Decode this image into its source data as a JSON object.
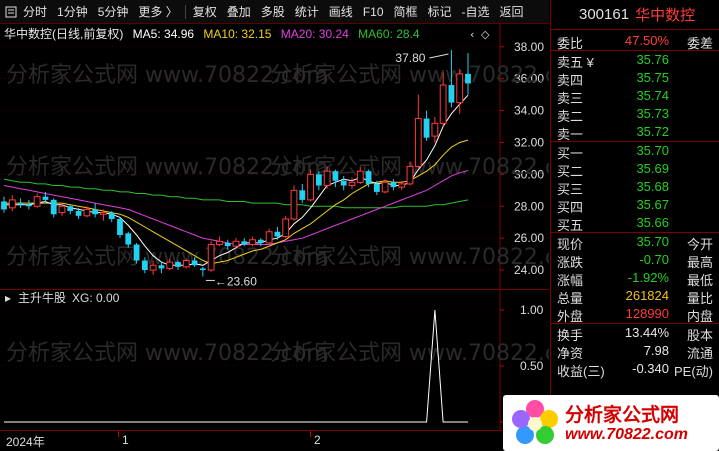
{
  "toolbar": {
    "items": [
      "分时",
      "1分钟",
      "5分钟",
      "更多 〉",
      "复权",
      "叠加",
      "多股",
      "统计",
      "画线",
      "F10",
      "简框",
      "标记",
      "-自选",
      "返回"
    ]
  },
  "stock": {
    "code": "300161",
    "name": "华中数控"
  },
  "chart_header": {
    "title": "华中数控(日线,前复权)",
    "ma5": "MA5: 34.96",
    "ma10": "MA10: 32.15",
    "ma20": "MA20: 30.24",
    "ma60": "MA60: 28.4"
  },
  "colors": {
    "up": "#ff3a3a",
    "down": "#22d0f0",
    "ma5": "#ffffff",
    "ma10": "#f0d020",
    "ma20": "#e040e0",
    "ma60": "#30c030",
    "grid": "#5a0000"
  },
  "price_axis": [
    "38.00",
    "36.00",
    "34.00",
    "32.00",
    "30.00",
    "28.00",
    "26.00",
    "24.00"
  ],
  "annotations": {
    "high": "37.80",
    "low": "23.60"
  },
  "indicator": {
    "name": "主升牛股",
    "xg": "XG: 0.00",
    "axis": [
      "1.00",
      "0.50",
      "0.00"
    ]
  },
  "xaxis": {
    "labels": [
      "2024年",
      "1",
      "2"
    ]
  },
  "quote": {
    "weibi_label": "委比",
    "weibi_val": "47.50%",
    "weicha_label": "委差",
    "asks": [
      {
        "label": "卖五 ¥",
        "price": "35.76"
      },
      {
        "label": "卖四",
        "price": "35.75"
      },
      {
        "label": "卖三",
        "price": "35.74"
      },
      {
        "label": "卖二",
        "price": "35.73"
      },
      {
        "label": "卖一",
        "price": "35.72"
      }
    ],
    "bids": [
      {
        "label": "买一",
        "price": "35.70"
      },
      {
        "label": "买二",
        "price": "35.69"
      },
      {
        "label": "买三",
        "price": "35.68"
      },
      {
        "label": "买四",
        "price": "35.67"
      },
      {
        "label": "买五",
        "price": "35.66"
      }
    ],
    "stats": [
      {
        "l1": "现价",
        "v": "35.70",
        "c": "green",
        "l2": "今开"
      },
      {
        "l1": "涨跌",
        "v": "-0.70",
        "c": "green",
        "l2": "最高"
      },
      {
        "l1": "涨幅",
        "v": "-1.92%",
        "c": "green",
        "l2": "最低"
      },
      {
        "l1": "总量",
        "v": "261824",
        "c": "yellow",
        "l2": "量比"
      },
      {
        "l1": "外盘",
        "v": "128990",
        "c": "red",
        "l2": "内盘"
      }
    ],
    "stats2": [
      {
        "l1": "换手",
        "v": "13.44%",
        "c": "white",
        "l2": "股本"
      },
      {
        "l1": "净资",
        "v": "7.98",
        "c": "white",
        "l2": "流通"
      },
      {
        "l1": "收益(三)",
        "v": "-0.340",
        "c": "white",
        "l2": "PE(动)"
      }
    ]
  },
  "logo": {
    "title": "分析家公式网",
    "url": "www.70822.com"
  },
  "watermark": "分析家公式网 www.70822.com",
  "chart_data": {
    "type": "candlestick",
    "title": "华中数控(日线,前复权)",
    "ylim": [
      23,
      38.8
    ],
    "candles": [
      {
        "o": 28.3,
        "c": 27.8,
        "h": 28.6,
        "l": 27.6
      },
      {
        "o": 27.9,
        "c": 28.4,
        "h": 28.7,
        "l": 27.7
      },
      {
        "o": 28.2,
        "c": 28.1,
        "h": 28.5,
        "l": 27.9
      },
      {
        "o": 28.1,
        "c": 28.0,
        "h": 28.4,
        "l": 27.8
      },
      {
        "o": 28.0,
        "c": 28.6,
        "h": 28.8,
        "l": 27.9
      },
      {
        "o": 28.6,
        "c": 28.4,
        "h": 28.9,
        "l": 28.2
      },
      {
        "o": 28.4,
        "c": 27.5,
        "h": 28.5,
        "l": 27.3
      },
      {
        "o": 27.6,
        "c": 28.0,
        "h": 28.2,
        "l": 27.4
      },
      {
        "o": 28.0,
        "c": 27.7,
        "h": 28.1,
        "l": 27.5
      },
      {
        "o": 27.7,
        "c": 27.4,
        "h": 27.9,
        "l": 27.2
      },
      {
        "o": 27.4,
        "c": 27.8,
        "h": 28.0,
        "l": 27.3
      },
      {
        "o": 27.8,
        "c": 27.5,
        "h": 28.2,
        "l": 27.3
      },
      {
        "o": 27.5,
        "c": 27.6,
        "h": 27.8,
        "l": 27.1
      },
      {
        "o": 27.6,
        "c": 27.2,
        "h": 27.7,
        "l": 27.0
      },
      {
        "o": 27.2,
        "c": 26.2,
        "h": 27.3,
        "l": 26.0
      },
      {
        "o": 26.3,
        "c": 25.6,
        "h": 26.4,
        "l": 25.4
      },
      {
        "o": 25.6,
        "c": 24.6,
        "h": 25.7,
        "l": 24.4
      },
      {
        "o": 24.6,
        "c": 24.0,
        "h": 24.8,
        "l": 23.8
      },
      {
        "o": 24.0,
        "c": 24.3,
        "h": 24.6,
        "l": 23.7
      },
      {
        "o": 24.3,
        "c": 24.1,
        "h": 24.5,
        "l": 23.8
      },
      {
        "o": 24.1,
        "c": 24.5,
        "h": 24.7,
        "l": 24.0
      },
      {
        "o": 24.5,
        "c": 24.2,
        "h": 24.6,
        "l": 24.0
      },
      {
        "o": 24.2,
        "c": 24.6,
        "h": 24.7,
        "l": 24.1
      },
      {
        "o": 24.6,
        "c": 24.3,
        "h": 24.8,
        "l": 24.2
      },
      {
        "o": 24.1,
        "c": 24.0,
        "h": 24.2,
        "l": 23.6
      },
      {
        "o": 24.0,
        "c": 25.6,
        "h": 25.8,
        "l": 23.9
      },
      {
        "o": 25.6,
        "c": 25.8,
        "h": 26.1,
        "l": 25.5
      },
      {
        "o": 25.7,
        "c": 25.5,
        "h": 25.9,
        "l": 25.3
      },
      {
        "o": 25.5,
        "c": 25.8,
        "h": 26.0,
        "l": 25.4
      },
      {
        "o": 25.8,
        "c": 25.6,
        "h": 26.0,
        "l": 25.5
      },
      {
        "o": 25.6,
        "c": 25.9,
        "h": 26.1,
        "l": 25.5
      },
      {
        "o": 25.9,
        "c": 25.7,
        "h": 26.0,
        "l": 25.5
      },
      {
        "o": 25.7,
        "c": 26.4,
        "h": 26.6,
        "l": 25.6
      },
      {
        "o": 26.4,
        "c": 26.1,
        "h": 26.7,
        "l": 25.9
      },
      {
        "o": 26.1,
        "c": 27.2,
        "h": 27.4,
        "l": 26.0
      },
      {
        "o": 27.2,
        "c": 29.0,
        "h": 29.3,
        "l": 27.1
      },
      {
        "o": 29.0,
        "c": 28.4,
        "h": 29.4,
        "l": 28.2
      },
      {
        "o": 28.4,
        "c": 30.0,
        "h": 30.3,
        "l": 28.3
      },
      {
        "o": 30.0,
        "c": 29.3,
        "h": 30.2,
        "l": 29.0
      },
      {
        "o": 29.3,
        "c": 30.2,
        "h": 30.5,
        "l": 29.1
      },
      {
        "o": 30.2,
        "c": 29.6,
        "h": 30.3,
        "l": 29.2
      },
      {
        "o": 29.6,
        "c": 29.3,
        "h": 29.9,
        "l": 29.0
      },
      {
        "o": 29.3,
        "c": 29.5,
        "h": 29.8,
        "l": 29.1
      },
      {
        "o": 29.5,
        "c": 30.2,
        "h": 30.5,
        "l": 29.4
      },
      {
        "o": 30.2,
        "c": 29.4,
        "h": 30.3,
        "l": 29.2
      },
      {
        "o": 29.4,
        "c": 28.9,
        "h": 29.6,
        "l": 28.7
      },
      {
        "o": 28.9,
        "c": 29.5,
        "h": 29.7,
        "l": 28.8
      },
      {
        "o": 29.5,
        "c": 29.2,
        "h": 29.7,
        "l": 29.0
      },
      {
        "o": 29.2,
        "c": 29.4,
        "h": 29.6,
        "l": 29.0
      },
      {
        "o": 29.4,
        "c": 30.5,
        "h": 30.8,
        "l": 29.3
      },
      {
        "o": 30.5,
        "c": 33.5,
        "h": 35.0,
        "l": 30.4
      },
      {
        "o": 33.5,
        "c": 32.3,
        "h": 34.0,
        "l": 32.1
      },
      {
        "o": 32.4,
        "c": 33.2,
        "h": 33.6,
        "l": 32.0
      },
      {
        "o": 33.2,
        "c": 35.6,
        "h": 36.4,
        "l": 33.0
      },
      {
        "o": 35.6,
        "c": 34.5,
        "h": 37.8,
        "l": 34.2
      },
      {
        "o": 34.5,
        "c": 36.3,
        "h": 36.6,
        "l": 33.8
      },
      {
        "o": 36.3,
        "c": 35.7,
        "h": 37.6,
        "l": 35.0
      }
    ],
    "ma5": [
      28.1,
      28.1,
      28.1,
      28.1,
      28.2,
      28.3,
      28.1,
      28.1,
      27.9,
      27.8,
      27.7,
      27.6,
      27.6,
      27.5,
      27.3,
      26.8,
      26.2,
      25.5,
      24.9,
      24.5,
      24.3,
      24.3,
      24.3,
      24.4,
      24.3,
      24.6,
      24.9,
      25.1,
      25.4,
      25.7,
      25.7,
      25.7,
      25.9,
      26.0,
      26.3,
      26.9,
      27.3,
      27.9,
      28.6,
      29.3,
      29.5,
      29.7,
      29.6,
      29.8,
      29.6,
      29.4,
      29.5,
      29.3,
      29.3,
      29.5,
      30.3,
      30.9,
      31.8,
      33.0,
      33.8,
      34.4,
      34.96
    ],
    "ma10": [
      28.2,
      28.2,
      28.2,
      28.2,
      28.2,
      28.2,
      28.2,
      28.2,
      28.1,
      28.0,
      27.9,
      27.8,
      27.7,
      27.6,
      27.5,
      27.3,
      27.0,
      26.7,
      26.4,
      26.1,
      25.8,
      25.5,
      25.2,
      24.9,
      24.6,
      24.4,
      24.5,
      24.6,
      24.8,
      25.0,
      25.2,
      25.3,
      25.5,
      25.7,
      25.9,
      26.3,
      26.6,
      26.9,
      27.3,
      27.7,
      28.1,
      28.4,
      28.8,
      29.1,
      29.4,
      29.5,
      29.6,
      29.5,
      29.5,
      29.6,
      29.9,
      30.2,
      30.6,
      31.2,
      31.7,
      32.0,
      32.15
    ],
    "ma20": [
      29.3,
      29.2,
      29.1,
      29.0,
      28.9,
      28.8,
      28.7,
      28.6,
      28.5,
      28.4,
      28.3,
      28.2,
      28.1,
      28.0,
      27.9,
      27.8,
      27.6,
      27.4,
      27.2,
      27.0,
      26.8,
      26.6,
      26.4,
      26.2,
      26.0,
      25.9,
      25.8,
      25.7,
      25.6,
      25.6,
      25.6,
      25.6,
      25.6,
      25.7,
      25.8,
      25.9,
      26.0,
      26.2,
      26.4,
      26.6,
      26.8,
      27.0,
      27.2,
      27.4,
      27.6,
      27.8,
      28.0,
      28.2,
      28.4,
      28.6,
      28.8,
      29.0,
      29.3,
      29.6,
      29.9,
      30.1,
      30.24
    ],
    "ma60": [
      29.7,
      29.6,
      29.5,
      29.5,
      29.4,
      29.4,
      29.3,
      29.3,
      29.2,
      29.2,
      29.1,
      29.1,
      29.0,
      29.0,
      28.9,
      28.9,
      28.8,
      28.8,
      28.7,
      28.7,
      28.6,
      28.6,
      28.5,
      28.5,
      28.4,
      28.4,
      28.4,
      28.3,
      28.3,
      28.3,
      28.2,
      28.2,
      28.2,
      28.2,
      28.1,
      28.1,
      28.1,
      28.0,
      28.0,
      28.0,
      28.0,
      27.9,
      27.9,
      27.9,
      27.9,
      27.9,
      27.9,
      27.9,
      28.0,
      28.0,
      28.0,
      28.0,
      28.1,
      28.1,
      28.2,
      28.3,
      28.4
    ],
    "indicator_values": [
      0,
      0,
      0,
      0,
      0,
      0,
      0,
      0,
      0,
      0,
      0,
      0,
      0,
      0,
      0,
      0,
      0,
      0,
      0,
      0,
      0,
      0,
      0,
      0,
      0,
      0,
      0,
      0,
      0,
      0,
      0,
      0,
      0,
      0,
      0,
      0,
      0,
      0,
      0,
      0,
      0,
      0,
      0,
      0,
      0,
      0,
      0,
      0,
      0,
      0,
      0,
      0,
      1,
      0,
      0,
      0,
      0
    ]
  }
}
